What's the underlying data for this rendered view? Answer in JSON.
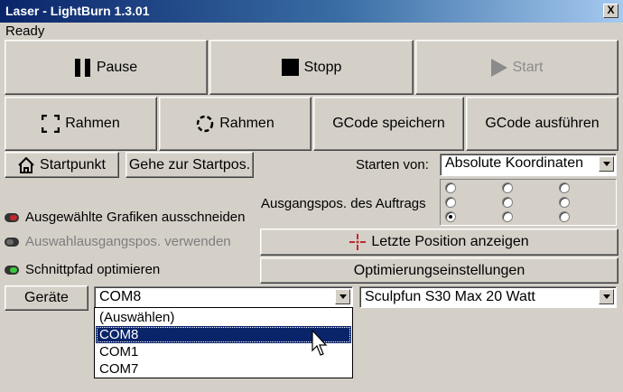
{
  "window": {
    "title": "Laser - LightBurn 1.3.01",
    "close_label": "X"
  },
  "status": "Ready",
  "controls": {
    "pause_label": "Pause",
    "stop_label": "Stopp",
    "start_label": "Start",
    "frame_rect_label": "Rahmen",
    "frame_circle_label": "Rahmen",
    "save_gcode_label": "GCode speichern",
    "run_gcode_label": "GCode ausführen",
    "home_label": "Startpunkt",
    "goto_origin_label": "Gehe zur Startpos."
  },
  "start_from": {
    "label": "Starten von:",
    "value": "Absolute Koordinaten"
  },
  "job_origin": {
    "label": "Ausgangspos. des Auftrags",
    "selected_index": 6
  },
  "options": [
    {
      "label": "Ausgewählte Grafiken ausschneiden",
      "state": "on-red",
      "enabled": true
    },
    {
      "label": "Auswahlausgangspos. verwenden",
      "state": "off",
      "enabled": false
    },
    {
      "label": "Schnittpfad optimieren",
      "state": "on-green",
      "enabled": true
    }
  ],
  "show_last_position_label": "Letzte Position anzeigen",
  "optimization_settings_label": "Optimierungseinstellungen",
  "devices_label": "Geräte",
  "port": {
    "value": "COM8",
    "options": [
      "(Auswählen)",
      "COM8",
      "COM1",
      "COM7"
    ],
    "highlighted_index": 1
  },
  "device": {
    "value": "Sculpfun S30 Max 20 Watt"
  },
  "colors": {
    "title_start": "#0a246a",
    "title_end": "#a6caf0",
    "selection": "#0a246a",
    "toggle_red": "#c0282d",
    "toggle_green": "#3cc83c"
  }
}
